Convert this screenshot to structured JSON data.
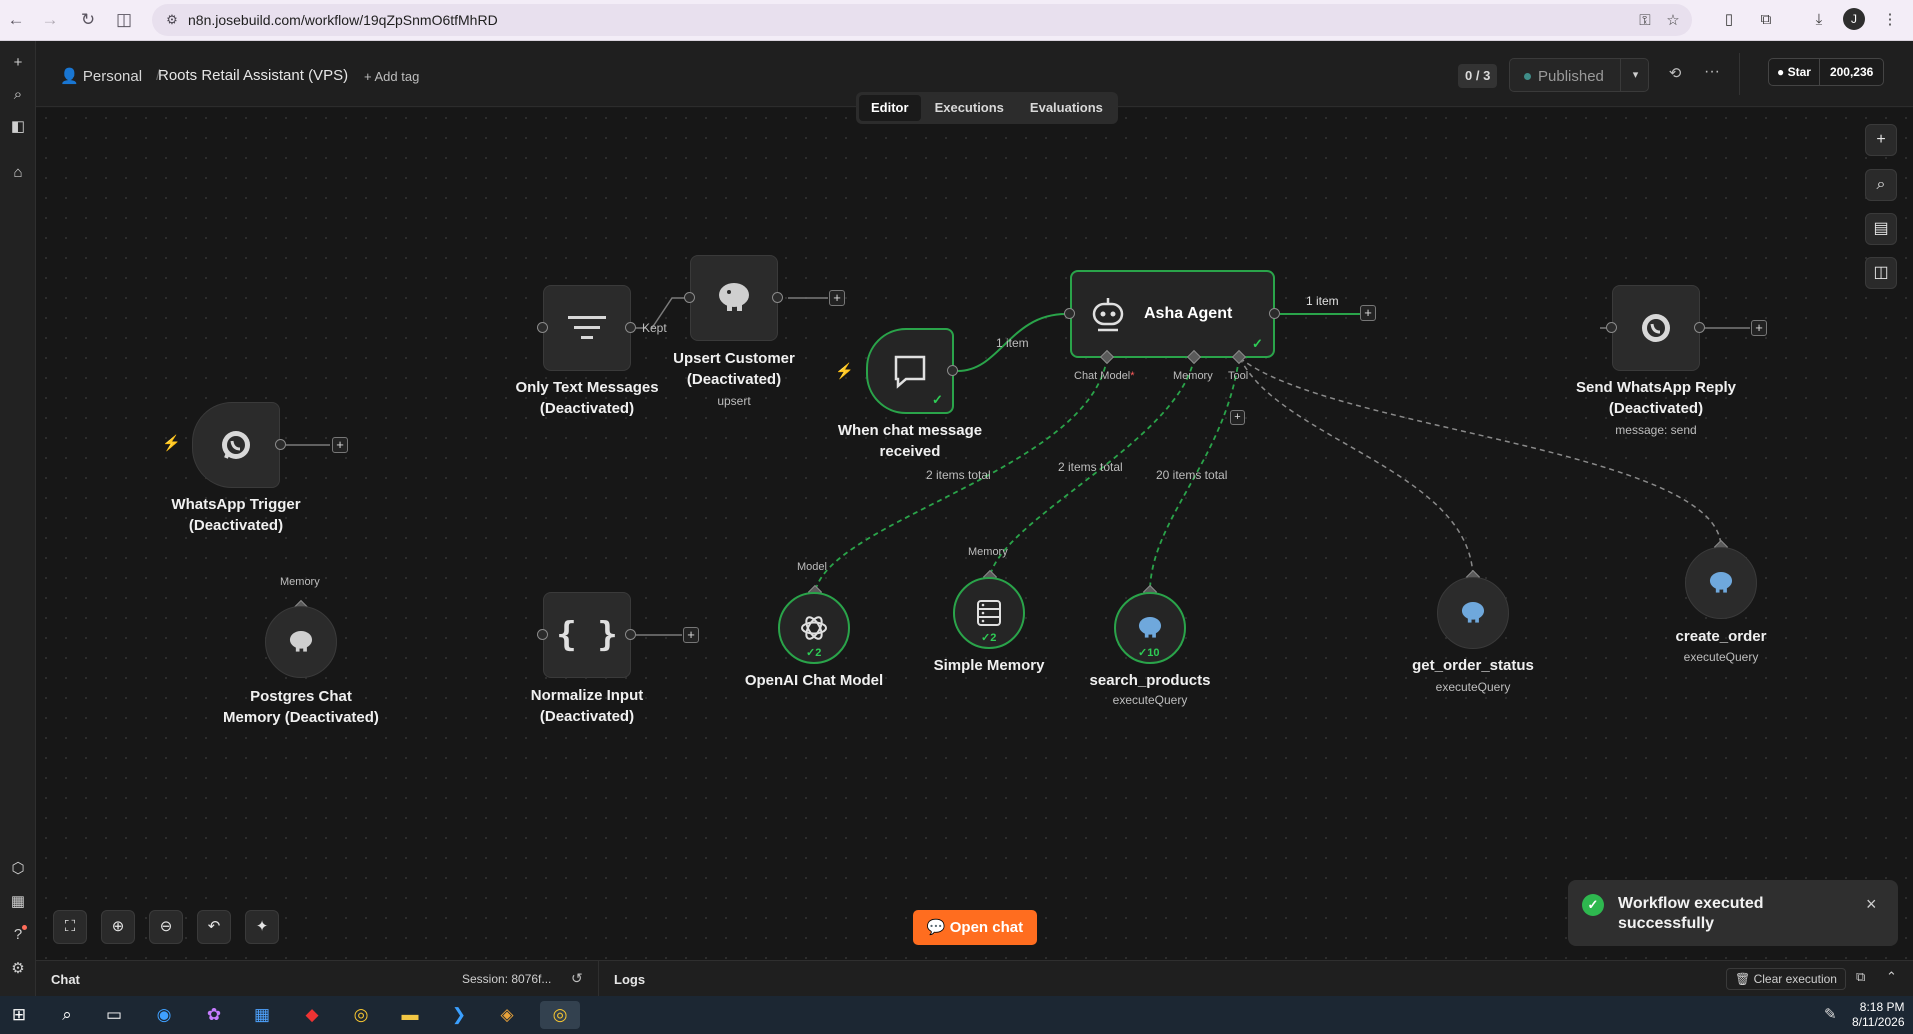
{
  "browser": {
    "url": "n8n.josebuild.com/workflow/19qZpSnmO6tfMhRD",
    "avatar_initial": "J"
  },
  "header": {
    "breadcrumb_personal": "Personal",
    "separator": "/",
    "workflow_title": "Roots Retail Assistant (VPS)",
    "add_tag": "+ Add tag",
    "counter": "0 / 3",
    "published_label": "Published",
    "github_star": "Star",
    "github_count": "200,236"
  },
  "tabs": [
    {
      "label": "Editor",
      "active": true
    },
    {
      "label": "Executions",
      "active": false
    },
    {
      "label": "Evaluations",
      "active": false
    }
  ],
  "nodes": {
    "whatsapp_trigger": {
      "label": "WhatsApp Trigger (Deactivated)"
    },
    "only_text": {
      "label": "Only Text Messages (Deactivated)"
    },
    "upsert_customer": {
      "label": "Upsert Customer (Deactivated)",
      "sub": "upsert"
    },
    "chat_trigger": {
      "label": "When chat message received"
    },
    "asha_agent": {
      "label": "Asha Agent",
      "in_chat_model": "Chat Model",
      "in_chat_model_required": "*",
      "in_memory": "Memory",
      "in_tool": "Tool"
    },
    "send_whatsapp": {
      "label": "Send WhatsApp Reply (Deactivated)",
      "sub": "message: send"
    },
    "pg_memory": {
      "label": "Postgres Chat Memory (Deactivated)",
      "port_label": "Memory"
    },
    "normalize": {
      "label": "Normalize Input (Deactivated)"
    },
    "openai": {
      "label": "OpenAI Chat Model",
      "port_label": "Model",
      "count": "2"
    },
    "simple_memory": {
      "label": "Simple Memory",
      "port_label": "Memory",
      "count": "2"
    },
    "search_products": {
      "label": "search_products",
      "sub": "executeQuery",
      "count": "10"
    },
    "get_order_status": {
      "label": "get_order_status",
      "sub": "executeQuery"
    },
    "create_order": {
      "label": "create_order",
      "sub": "executeQuery"
    }
  },
  "wire_labels": {
    "kept": "Kept",
    "chat_to_agent": "1 item",
    "agent_out": "1 item",
    "model_items": "2 items total",
    "memory_items": "2 items total",
    "tool_items": "20 items total"
  },
  "controls": {
    "open_chat": "Open chat",
    "toast": "Workflow executed successfully"
  },
  "bottom_panel": {
    "chat": "Chat",
    "session": "Session: 8076f...",
    "logs": "Logs",
    "clear_execution": "Clear execution"
  },
  "taskbar": {
    "time": "8:18 PM",
    "date": "8/11/2026"
  },
  "colors": {
    "accent": "#ff6d1f",
    "success": "#2aa44a",
    "canvas": "#171717"
  }
}
